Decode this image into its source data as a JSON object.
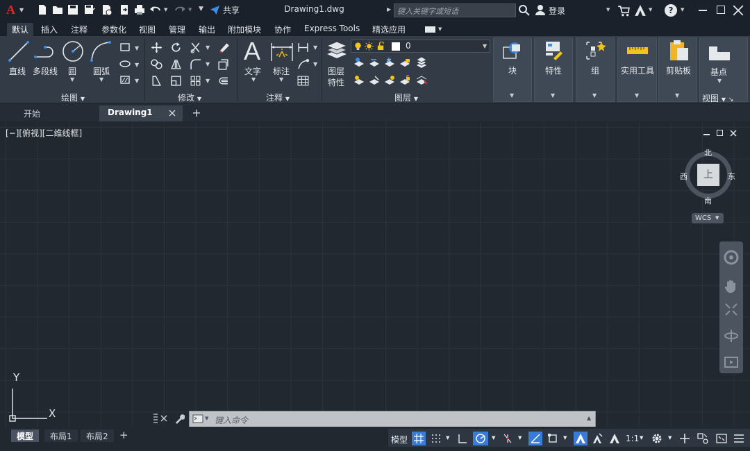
{
  "titlebar": {
    "app_logo": "A",
    "share_label": "共享",
    "document_title": "Drawing1.dwg",
    "search_placeholder": "键入关键字或短语",
    "login_label": "登录"
  },
  "ribbon_tabs": [
    "默认",
    "插入",
    "注释",
    "参数化",
    "视图",
    "管理",
    "输出",
    "附加模块",
    "协作",
    "Express Tools",
    "精选应用"
  ],
  "ribbon": {
    "draw": {
      "title": "绘图",
      "line": "直线",
      "polyline": "多段线",
      "circle": "圆",
      "arc": "圆弧"
    },
    "modify": {
      "title": "修改"
    },
    "annotation": {
      "title": "注释",
      "text": "文字",
      "dimension": "标注"
    },
    "layers": {
      "title": "图层",
      "layer_properties_1": "图层",
      "layer_properties_2": "特性",
      "current_layer": "0"
    },
    "block": "块",
    "properties": "特性",
    "groups": "组",
    "utilities": "实用工具",
    "clipboard": "剪贴板",
    "view": {
      "basepoint": "基点",
      "title": "视图"
    }
  },
  "file_tabs": {
    "start": "开始",
    "drawing": "Drawing1"
  },
  "viewport": {
    "label": "[−][俯视][二维线框]",
    "viewcube": {
      "north": "北",
      "south": "南",
      "east": "东",
      "west": "西",
      "face": "上"
    },
    "wcs": "WCS",
    "ucs_y": "Y",
    "ucs_x": "X"
  },
  "command_line": {
    "placeholder": "键入命令"
  },
  "layout_tabs": [
    "模型",
    "布局1",
    "布局2"
  ],
  "status": {
    "model_label": "模型",
    "scale_label": "1:1"
  },
  "colors": {
    "accent": "#3a7bd5",
    "logo_red": "#e0242b",
    "background": "#212830"
  }
}
